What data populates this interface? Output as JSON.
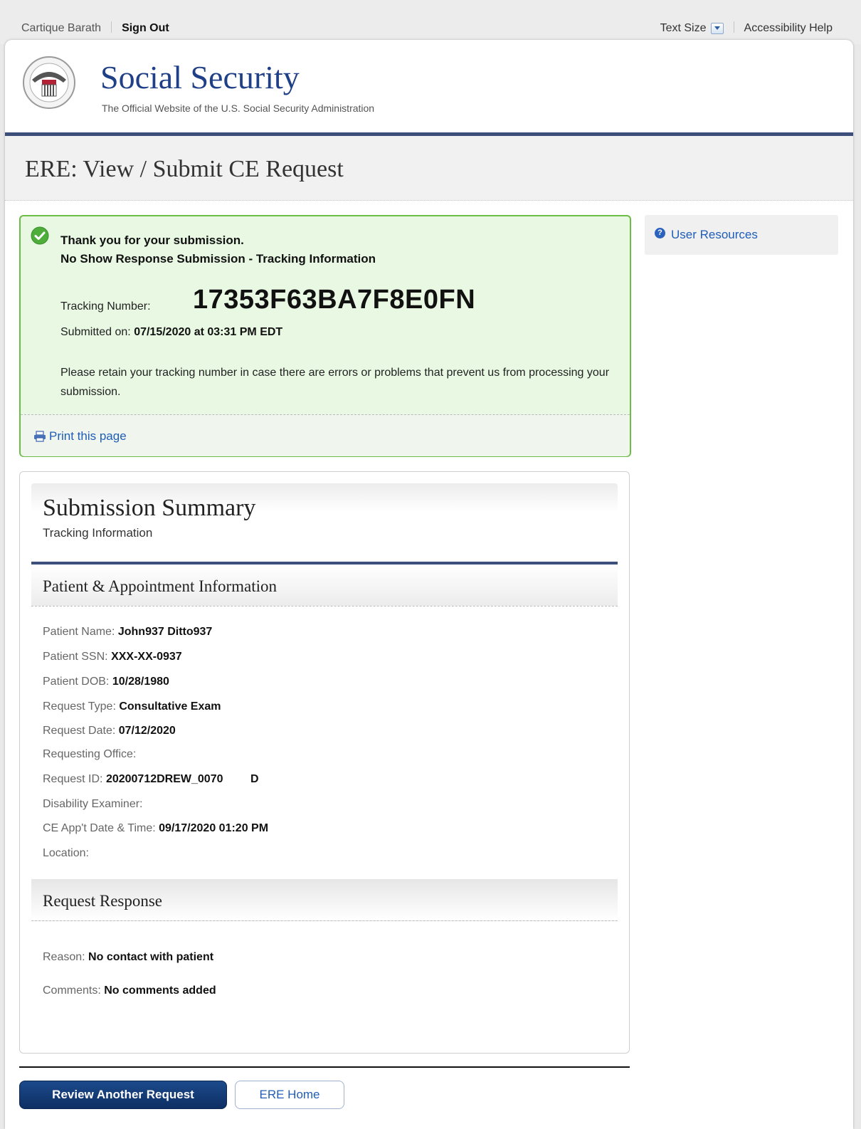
{
  "topbar": {
    "user_name": "Cartique Barath",
    "sign_out": "Sign Out",
    "text_size": "Text Size",
    "accessibility_help": "Accessibility Help"
  },
  "header": {
    "site_title": "Social Security",
    "site_subtitle": "The Official Website of the U.S. Social Security Administration"
  },
  "page": {
    "title": "ERE: View / Submit CE Request"
  },
  "success": {
    "line1": "Thank you for your submission.",
    "line2": "No Show Response Submission - Tracking Information",
    "tracking_label": "Tracking Number:",
    "tracking_number": "17353F63BA7F8E0FN",
    "submitted_label": "Submitted on:",
    "submitted_value": "07/15/2020 at 03:31 PM EDT",
    "retain_text": "Please retain your tracking number in case there are errors or problems that prevent us from processing your submission.",
    "print_link": "Print this page"
  },
  "sidebar": {
    "user_resources": "User Resources"
  },
  "summary": {
    "title": "Submission Summary",
    "subtitle": "Tracking Information",
    "section1_title": "Patient & Appointment Information",
    "fields": [
      {
        "label": "Patient Name:",
        "value": "John937 Ditto937"
      },
      {
        "label": "Patient SSN:",
        "value": "XXX-XX-0937"
      },
      {
        "label": "Patient DOB:",
        "value": "10/28/1980"
      },
      {
        "label": "Request Type:",
        "value": "Consultative Exam"
      },
      {
        "label": "Request Date:",
        "value": "07/12/2020"
      },
      {
        "label": "Requesting Office:",
        "value": ""
      },
      {
        "label": "Request ID:",
        "value": "20200712DREW_0070",
        "suffix": "D"
      },
      {
        "label": "Disability Examiner:",
        "value": ""
      },
      {
        "label": "CE App't Date & Time:",
        "value": "09/17/2020 01:20 PM"
      },
      {
        "label": "Location:",
        "value": ""
      }
    ],
    "section2_title": "Request Response",
    "response": [
      {
        "label": "Reason:",
        "value": "No contact with patient"
      },
      {
        "label": "Comments:",
        "value": "No comments added"
      }
    ]
  },
  "buttons": {
    "review_another": "Review Another Request",
    "ere_home": "ERE Home"
  },
  "colors": {
    "brand_blue": "#1f3f86",
    "header_rule": "#3b4f7a",
    "success_border": "#6cbd45",
    "success_bg": "#e8f8e3",
    "link": "#1f5db8"
  }
}
